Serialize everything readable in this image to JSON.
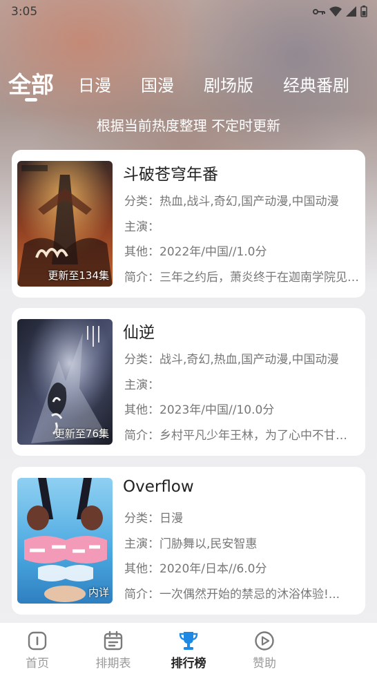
{
  "status_bar": {
    "time": "3:05"
  },
  "tabs": [
    {
      "label": "全部",
      "active": true
    },
    {
      "label": "日漫",
      "active": false
    },
    {
      "label": "国漫",
      "active": false
    },
    {
      "label": "剧场版",
      "active": false
    },
    {
      "label": "经典番剧",
      "active": false
    }
  ],
  "subtitle": "根据当前热度整理 不定时更新",
  "cards": [
    {
      "title": "斗破苍穹年番",
      "badge": "更新至134集",
      "category": "分类：热血,战斗,奇幻,国产动漫,中国动漫",
      "cast": "主演：",
      "other": "其他：2022年/中国//1.0分",
      "intro": "简介：三年之约后，萧炎终于在迦南学院见到…",
      "poster_colors": [
        "#3b2a26",
        "#c9642e",
        "#e8b060"
      ]
    },
    {
      "title": "仙逆",
      "badge": "更新至76集",
      "category": "分类：战斗,奇幻,热血,国产动漫,中国动漫",
      "cast": "主演：",
      "other": "其他：2023年/中国//10.0分",
      "intro": "简介：乡村平凡少年王林，为了心中不甘…",
      "poster_colors": [
        "#1e2230",
        "#8a93b5",
        "#d8dcea"
      ]
    },
    {
      "title": "Overflow",
      "badge": "内详",
      "category": "分类：日漫",
      "cast": "主演：门胁舞以,民安智惠",
      "other": "其他：2020年/日本//6.0分",
      "intro": "简介：一次偶然开始的禁忌的沐浴体验!...",
      "poster_colors": [
        "#4aa8e0",
        "#f29ab8",
        "#ffffff"
      ]
    }
  ],
  "bottom_nav": [
    {
      "label": "首页",
      "icon": "home-icon",
      "active": false
    },
    {
      "label": "排期表",
      "icon": "calendar-icon",
      "active": false
    },
    {
      "label": "排行榜",
      "icon": "trophy-icon",
      "active": true
    },
    {
      "label": "赞助",
      "icon": "play-circle-icon",
      "active": false
    }
  ],
  "colors": {
    "accent": "#1e88e5",
    "inactive": "#9a9a9a",
    "text": "#222222"
  }
}
